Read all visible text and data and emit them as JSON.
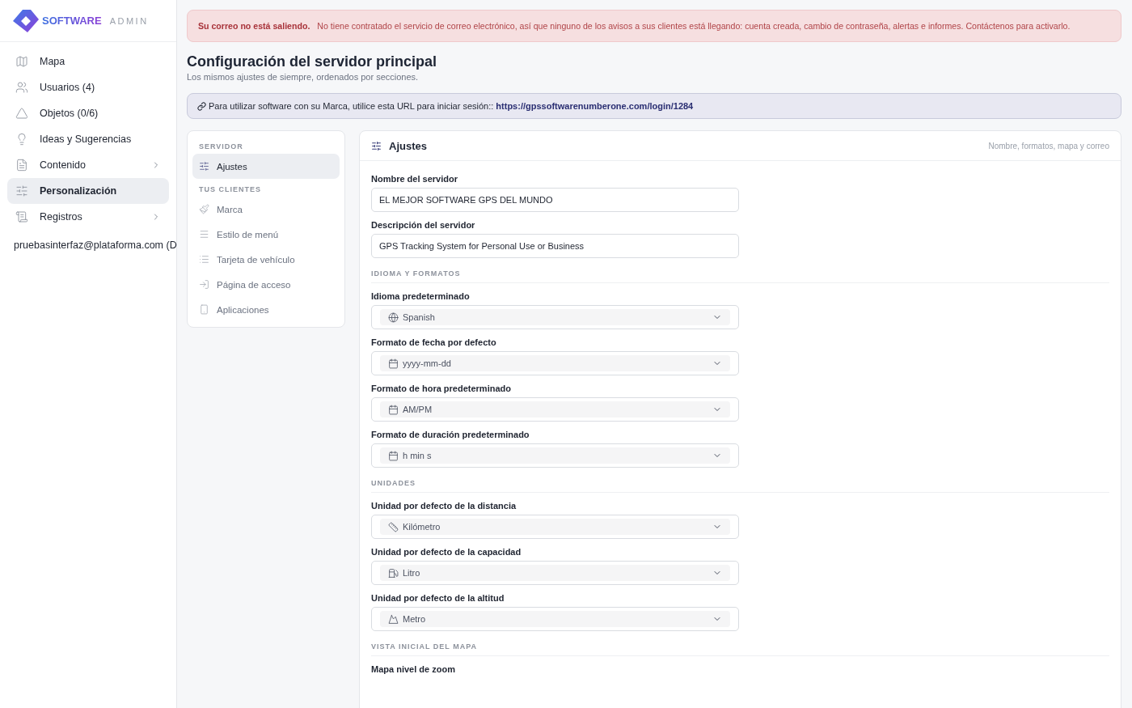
{
  "brand": {
    "name": "SOFTWARE",
    "suffix": "ADMIN"
  },
  "sidebar": {
    "items": [
      {
        "label": "Mapa",
        "selected": false,
        "expandable": false
      },
      {
        "label": "Usuarios (4)",
        "selected": false,
        "expandable": false
      },
      {
        "label": "Objetos (0/6)",
        "selected": false,
        "expandable": false
      },
      {
        "label": "Ideas y Sugerencias",
        "selected": false,
        "expandable": false
      },
      {
        "label": "Contenido",
        "selected": false,
        "expandable": true
      },
      {
        "label": "Personalización",
        "selected": true,
        "expandable": false
      },
      {
        "label": "Registros",
        "selected": false,
        "expandable": true
      }
    ],
    "account": "pruebasinterfaz@plataforma.com (D"
  },
  "alert": {
    "title": "Su correo no está saliendo.",
    "message": "No tiene contratado el servicio de correo electrónico, así que ninguno de los avisos a sus clientes está llegando: cuenta creada, cambio de contraseña, alertas e informes. Contáctenos para activarlo."
  },
  "page": {
    "title": "Configuración del servidor principal",
    "subtitle": "Los mismos ajustes de siempre, ordenados por secciones."
  },
  "url_notice": {
    "text": "Para utilizar software con su Marca, utilice esta URL para iniciar sesión::",
    "url": "https://gpssoftwarenumberone.com/login/1284"
  },
  "subnav": [
    {
      "heading": "SERVIDOR",
      "items": [
        {
          "label": "Ajustes",
          "selected": true
        }
      ]
    },
    {
      "heading": "TUS CLIENTES",
      "items": [
        {
          "label": "Marca",
          "selected": false
        },
        {
          "label": "Estilo de menú",
          "selected": false
        },
        {
          "label": "Tarjeta de vehículo",
          "selected": false
        },
        {
          "label": "Página de acceso",
          "selected": false
        },
        {
          "label": "Aplicaciones",
          "selected": false
        }
      ]
    }
  ],
  "card": {
    "title": "Ajustes",
    "hint": "Nombre, formatos, mapa y correo",
    "sections": [
      {
        "fields": [
          {
            "kind": "text",
            "label": "Nombre del servidor",
            "value": "EL MEJOR SOFTWARE GPS DEL MUNDO"
          },
          {
            "kind": "text",
            "label": "Descripción del servidor",
            "value": "GPS Tracking System for Personal Use or Business"
          }
        ]
      },
      {
        "heading": "IDIOMA Y FORMATOS",
        "fields": [
          {
            "kind": "select",
            "label": "Idioma predeterminado",
            "value": "Spanish"
          },
          {
            "kind": "select",
            "label": "Formato de fecha por defecto",
            "value": "yyyy-mm-dd"
          },
          {
            "kind": "select",
            "label": "Formato de hora predeterminado",
            "value": "AM/PM"
          },
          {
            "kind": "select",
            "label": "Formato de duración predeterminado",
            "value": "h min s"
          }
        ]
      },
      {
        "heading": "UNIDADES",
        "fields": [
          {
            "kind": "select",
            "label": "Unidad por defecto de la distancia",
            "value": "Kilómetro"
          },
          {
            "kind": "select",
            "label": "Unidad por defecto de la capacidad",
            "value": "Litro"
          },
          {
            "kind": "select",
            "label": "Unidad por defecto de la altitud",
            "value": "Metro"
          }
        ]
      },
      {
        "heading": "VISTA INICIAL DEL MAPA",
        "fields": [
          {
            "kind": "label",
            "label": "Mapa nivel de zoom"
          }
        ]
      }
    ]
  }
}
